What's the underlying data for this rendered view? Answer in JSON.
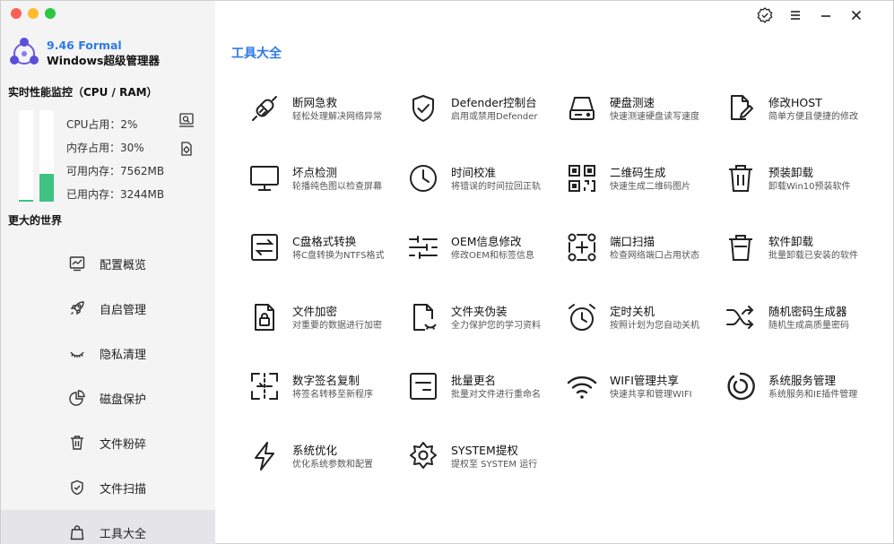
{
  "brand": {
    "version": "9.46 Formal",
    "name": "Windows超级管理器"
  },
  "monitor": {
    "title": "实时性能监控（CPU / RAM）",
    "cpu_label": "CPU占用：2%",
    "mem_label": "内存占用：30%",
    "avail_label": "可用内存：7562MB",
    "used_label": "已用内存：3244MB",
    "cpu_fraction": 0.02,
    "mem_fraction": 0.3
  },
  "slogan": "更大的世界",
  "nav": [
    {
      "label": "配置概览",
      "icon": "chart-icon"
    },
    {
      "label": "自启管理",
      "icon": "rocket-icon"
    },
    {
      "label": "隐私清理",
      "icon": "eye-closed-icon"
    },
    {
      "label": "磁盘保护",
      "icon": "pie-icon"
    },
    {
      "label": "文件粉碎",
      "icon": "trash-icon"
    },
    {
      "label": "文件扫描",
      "icon": "shield-check-icon"
    },
    {
      "label": "工具大全",
      "icon": "bag-icon"
    }
  ],
  "main": {
    "title": "工具大全",
    "tools": [
      {
        "name": "断网急救",
        "desc": "轻松处理解决网络异常",
        "icon": "plug-icon"
      },
      {
        "name": "Defender控制台",
        "desc": "启用或禁用Defender",
        "icon": "shield-icon"
      },
      {
        "name": "硬盘测速",
        "desc": "快速测速硬盘读写速度",
        "icon": "drive-icon"
      },
      {
        "name": "修改HOST",
        "desc": "简单方便且便捷的修改",
        "icon": "file-edit-icon"
      },
      {
        "name": "坏点检测",
        "desc": "轮播纯色图以检查屏幕",
        "icon": "monitor-icon"
      },
      {
        "name": "时间校准",
        "desc": "将错误的时间拉回正轨",
        "icon": "clock-icon"
      },
      {
        "name": "二维码生成",
        "desc": "快速生成二维码图片",
        "icon": "qrcode-icon"
      },
      {
        "name": "预装卸载",
        "desc": "卸载Win10预装软件",
        "icon": "trash-icon"
      },
      {
        "name": "C盘格式转换",
        "desc": "将C盘转换为NTFS格式",
        "icon": "convert-icon"
      },
      {
        "name": "OEM信息修改",
        "desc": "修改OEM和标签信息",
        "icon": "sliders-icon"
      },
      {
        "name": "端口扫描",
        "desc": "检查网络端口占用状态",
        "icon": "scan-icon"
      },
      {
        "name": "软件卸载",
        "desc": "批量卸载已安装的软件",
        "icon": "bin-icon"
      },
      {
        "name": "文件加密",
        "desc": "对重要的数据进行加密",
        "icon": "file-lock-icon"
      },
      {
        "name": "文件夹伪装",
        "desc": "全力保护您的学习资料",
        "icon": "file-hide-icon"
      },
      {
        "name": "定时关机",
        "desc": "按照计划为您自动关机",
        "icon": "alarm-icon"
      },
      {
        "name": "随机密码生成器",
        "desc": "随机生成高质量密码",
        "icon": "shuffle-icon"
      },
      {
        "name": "数字签名复制",
        "desc": "将签名转移至新程序",
        "icon": "signature-icon"
      },
      {
        "name": "批量更名",
        "desc": "批量对文件进行重命名",
        "icon": "rename-icon"
      },
      {
        "name": "WIFI管理共享",
        "desc": "快速共享和管理WIFI",
        "icon": "wifi-icon"
      },
      {
        "name": "系统服务管理",
        "desc": "系统服务和IE插件管理",
        "icon": "service-icon"
      },
      {
        "name": "系统优化",
        "desc": "优化系统参数和配置",
        "icon": "bolt-icon"
      },
      {
        "name": "SYSTEM提权",
        "desc": "提权至 SYSTEM 运行",
        "icon": "gear-cog-icon"
      }
    ]
  },
  "colors": {
    "accent": "#2f7ae5",
    "bar_fill": "#3ec383",
    "sidebar_bg": "#f4f4f5"
  }
}
